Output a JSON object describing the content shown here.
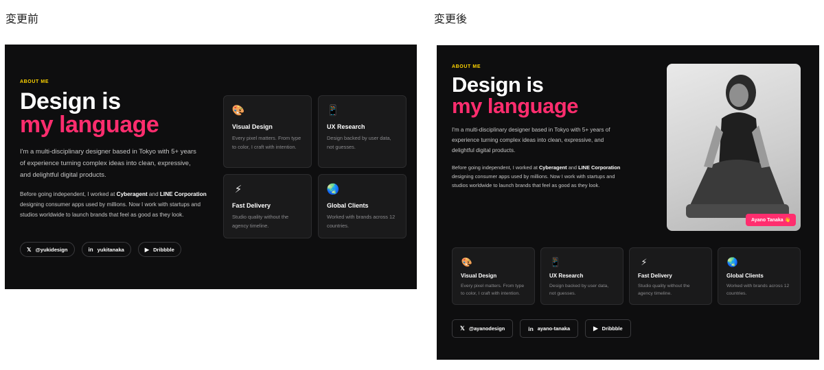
{
  "captions": {
    "before": "変更前",
    "after": "変更後"
  },
  "before": {
    "eyebrow": "ABOUT ME",
    "headline": {
      "line1": "Design is",
      "line2": "my language"
    },
    "intro": "I'm a multi-disciplinary designer based in Tokyo with 5+ years of experience turning complex ideas into clean, expressive, and delightful digital products.",
    "bio": {
      "before_text": "Before going independent, I worked at ",
      "company1": "Cyberagent",
      "and_text": " and ",
      "company2": "LINE Corporation",
      "after_text": " designing consumer apps used by millions. Now I work with startups and studios worldwide to launch brands that feel as good as they look."
    },
    "cards": [
      {
        "icon": "palette-icon",
        "glyph": "🎨",
        "title": "Visual Design",
        "desc": "Every pixel matters. From type to color, I craft with intention."
      },
      {
        "icon": "phone-icon",
        "glyph": "📱",
        "title": "UX Research",
        "desc": "Design backed by user data, not guesses."
      },
      {
        "icon": "bolt-icon",
        "glyph": "⚡",
        "title": "Fast Delivery",
        "desc": "Studio quality without the agency timeline."
      },
      {
        "icon": "globe-icon",
        "glyph": "🌏",
        "title": "Global Clients",
        "desc": "Worked with brands across 12 countries."
      }
    ],
    "socials": [
      {
        "icon": "x-icon",
        "glyph": "𝕏",
        "label": "@yukidesign"
      },
      {
        "icon": "linkedin-icon",
        "glyph": "in",
        "label": "yukitanaka"
      },
      {
        "icon": "play-icon",
        "glyph": "▶",
        "label": "Dribbble"
      }
    ]
  },
  "after": {
    "eyebrow": "ABOUT ME",
    "headline": {
      "line1": "Design is",
      "line2": "my language"
    },
    "intro": "I'm a multi-disciplinary designer based in Tokyo with 5+ years of experience turning complex ideas into clean, expressive, and delightful digital products.",
    "bio": {
      "before_text": "Before going independent, I worked at ",
      "company1": "Cyberagent",
      "and_text": " and ",
      "company2": "LINE Corporation",
      "after_text": " designing consumer apps used by millions. Now I work with startups and studios worldwide to launch brands that feel as good as they look."
    },
    "photo_badge": "Ayano Tanaka 👋",
    "cards": [
      {
        "icon": "palette-icon",
        "glyph": "🎨",
        "title": "Visual Design",
        "desc": "Every pixel matters. From type to color, I craft with intention."
      },
      {
        "icon": "phone-icon",
        "glyph": "📱",
        "title": "UX Research",
        "desc": "Design backed by user data, not guesses."
      },
      {
        "icon": "bolt-icon",
        "glyph": "⚡",
        "title": "Fast Delivery",
        "desc": "Studio quality without the agency timeline."
      },
      {
        "icon": "globe-icon",
        "glyph": "🌏",
        "title": "Global Clients",
        "desc": "Worked with brands across 12 countries."
      }
    ],
    "socials": [
      {
        "icon": "x-icon",
        "glyph": "𝕏",
        "label": "@ayanodesign"
      },
      {
        "icon": "linkedin-icon",
        "glyph": "in",
        "label": "ayano-tanaka"
      },
      {
        "icon": "play-icon",
        "glyph": "▶",
        "label": "Dribbble"
      }
    ]
  },
  "colors": {
    "background": "#0e0e0f",
    "accent": "#ff2d6e",
    "eyebrow": "#ffd400",
    "card": "#1a1a1b"
  }
}
